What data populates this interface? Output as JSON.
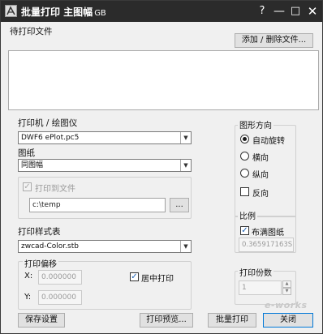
{
  "window": {
    "title": "批量打印 主图幅",
    "title_suffix": "GB",
    "controls": {
      "help": "?",
      "minimize": "—",
      "maximize": "□",
      "close": "✕"
    }
  },
  "pending_files": {
    "label": "待打印文件",
    "add_remove_button": "添加 / 删除文件..."
  },
  "printer": {
    "label": "打印机 / 绘图仪",
    "selected": "DWF6 ePlot.pc5"
  },
  "paper": {
    "label": "图纸",
    "selected": "同图幅"
  },
  "print_to_file": {
    "label": "打印到文件",
    "checked": true,
    "path": "c:\\temp",
    "browse_button": "..."
  },
  "plot_style_table": {
    "label": "打印样式表",
    "selected": "zwcad-Color.stb"
  },
  "plot_offset": {
    "label": "打印偏移",
    "x_label": "X:",
    "x_value": "0.000000",
    "y_label": "Y:",
    "y_value": "0.000000",
    "center_label": "居中打印",
    "center_checked": true
  },
  "orientation": {
    "label": "图形方向",
    "options": [
      "自动旋转",
      "横向",
      "纵向"
    ],
    "selected": "自动旋转",
    "reverse_label": "反向",
    "reverse_checked": false
  },
  "scale": {
    "label": "比例",
    "fit_label": "布满图纸",
    "fit_checked": true,
    "value": "0.365917163S"
  },
  "copies": {
    "label": "打印份数",
    "value": "1"
  },
  "buttons": {
    "save_settings": "保存设置",
    "print_preview": "打印预览...",
    "batch_print": "批量打印",
    "close": "关闭"
  },
  "watermark_text": "e-works"
}
